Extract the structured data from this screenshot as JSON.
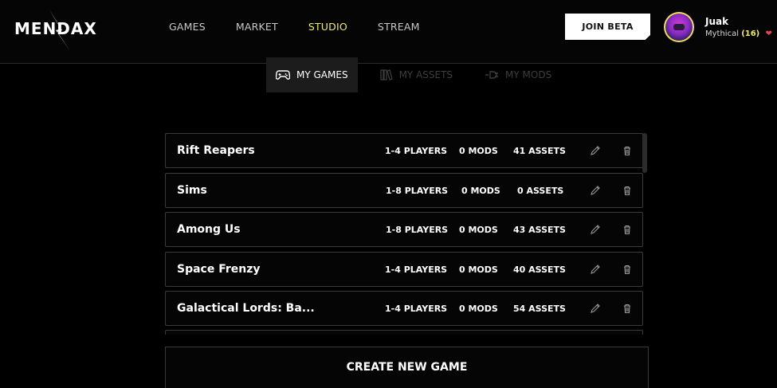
{
  "header": {
    "logo": "MENDAX",
    "nav": [
      "GAMES",
      "MARKET",
      "STUDIO",
      "STREAM"
    ],
    "active_nav": "STUDIO",
    "join_beta": "JOIN BETA",
    "user": {
      "name": "Juak",
      "rank": "Mythical",
      "level": "(16)",
      "hearts": "1"
    }
  },
  "subtabs": [
    {
      "label": "MY GAMES",
      "icon": "gamepad-icon",
      "active": true
    },
    {
      "label": "MY ASSETS",
      "icon": "books-icon",
      "active": false
    },
    {
      "label": "MY MODS",
      "icon": "plug-icon",
      "active": false
    }
  ],
  "games": [
    {
      "name": "Rift Reapers",
      "players": "1-4 PLAYERS",
      "mods": "0 MODS",
      "assets": "41 ASSETS"
    },
    {
      "name": "Sims",
      "players": "1-8 PLAYERS",
      "mods": "0 MODS",
      "assets": "0 ASSETS"
    },
    {
      "name": "Among Us",
      "players": "1-8 PLAYERS",
      "mods": "0 MODS",
      "assets": "43 ASSETS"
    },
    {
      "name": "Space Frenzy",
      "players": "1-4 PLAYERS",
      "mods": "0 MODS",
      "assets": "40 ASSETS"
    },
    {
      "name": "Galactical Lords: Ba...",
      "players": "1-4 PLAYERS",
      "mods": "0 MODS",
      "assets": "54 ASSETS"
    }
  ],
  "create_button": "CREATE NEW GAME",
  "colors": {
    "accent": "#f0ea5e",
    "background": "#000000",
    "border": "#3a3a3a"
  }
}
